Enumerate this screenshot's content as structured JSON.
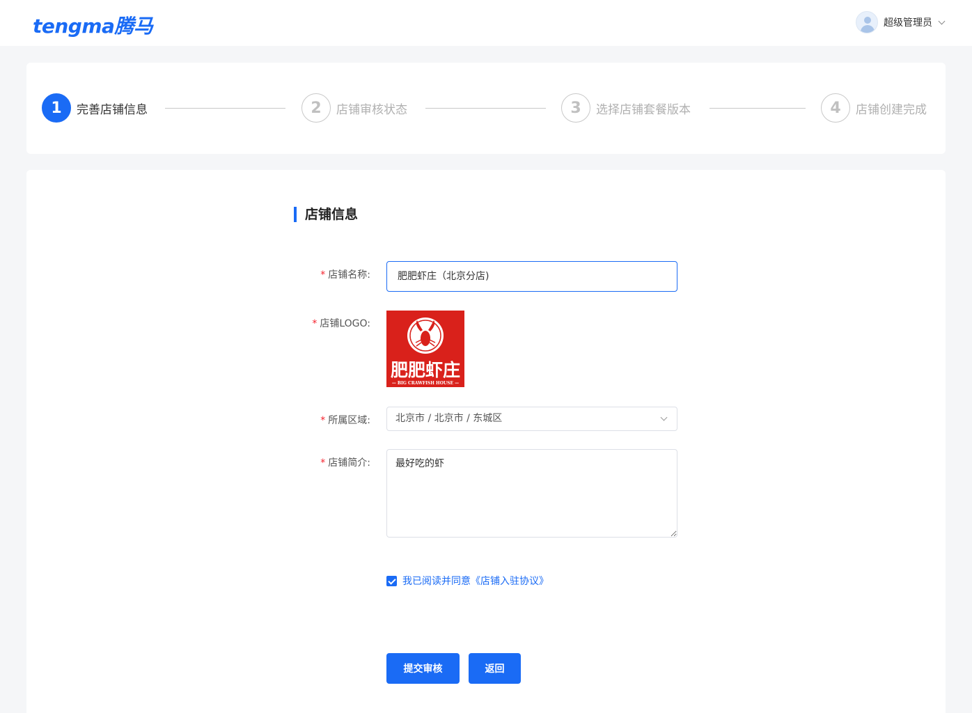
{
  "header": {
    "logo_text": "tengma腾马",
    "user_name": "超级管理员"
  },
  "steps": [
    {
      "num": "1",
      "label": "完善店铺信息",
      "active": true
    },
    {
      "num": "2",
      "label": "店铺审核状态",
      "active": false
    },
    {
      "num": "3",
      "label": "选择店铺套餐版本",
      "active": false
    },
    {
      "num": "4",
      "label": "店铺创建完成",
      "active": false
    }
  ],
  "form": {
    "section_title": "店铺信息",
    "required_mark": "*",
    "name_label": "店铺名称:",
    "name_value": "肥肥虾庄（北京分店)",
    "logo_label": "店铺LOGO:",
    "logo_image": {
      "main_text": "肥肥虾庄",
      "sub_text": "— BIG CRAWFISH HOUSE —"
    },
    "region_label": "所属区域:",
    "region_value": "北京市 / 北京市 / 东城区",
    "intro_label": "店铺简介:",
    "intro_value": "最好吃的虾",
    "agreement_text": "我已阅读并同意《店铺入驻协议》",
    "agreement_checked": true,
    "submit_label": "提交审核",
    "back_label": "返回"
  },
  "colors": {
    "primary": "#1a6bf5",
    "required": "#f5222d",
    "logo_bg": "#d9211b",
    "page_bg": "#f5f6f8"
  }
}
